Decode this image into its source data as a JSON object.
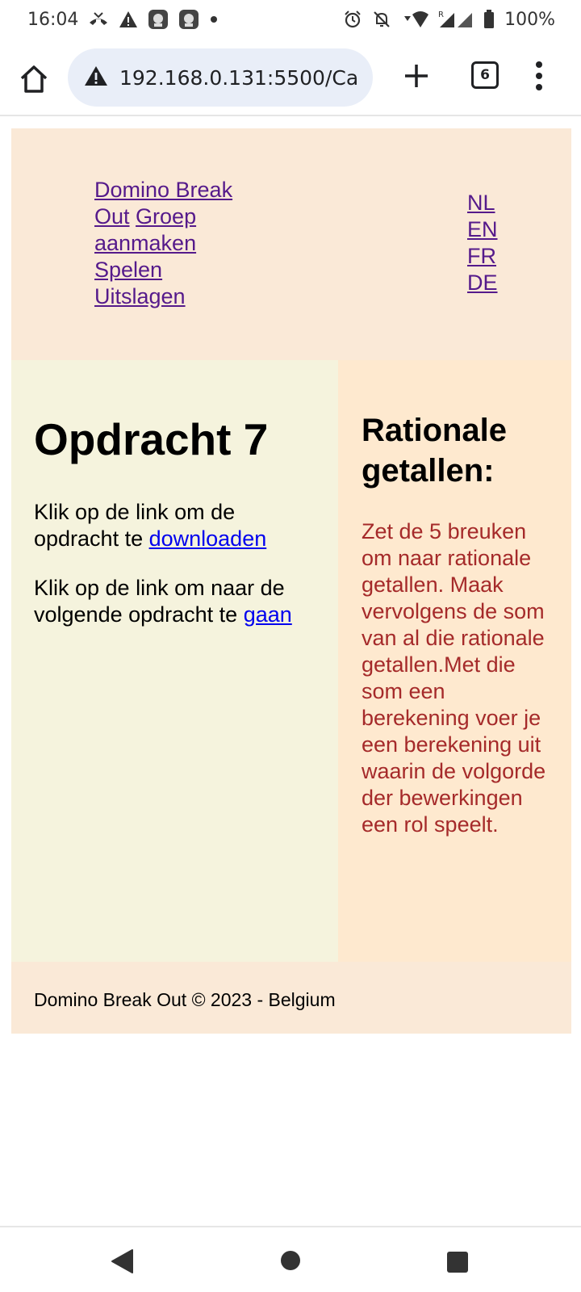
{
  "status_bar": {
    "time": "16:04",
    "battery": "100%",
    "icons_left": [
      "missed-call-icon",
      "warning-icon",
      "app-icon",
      "app-icon",
      "dot-icon"
    ],
    "icons_right": [
      "alarm-icon",
      "mute-icon",
      "wifi-icon",
      "signal-icon",
      "battery-icon"
    ]
  },
  "browser": {
    "url": "192.168.0.131:5500/Ca",
    "tab_count": "6"
  },
  "header": {
    "nav": [
      {
        "label": "Domino Break Out"
      },
      {
        "label": "Groep aanmaken"
      },
      {
        "label": "Spelen"
      },
      {
        "label": "Uitslagen"
      }
    ],
    "languages": [
      "NL",
      "EN",
      "FR",
      "DE"
    ]
  },
  "main": {
    "title": "Opdracht 7",
    "para1_text": "Klik op de link om de opdracht te ",
    "para1_link": "downloaden",
    "para2_text": "Klik op de link om naar de volgende opdracht te ",
    "para2_link": "gaan"
  },
  "aside": {
    "title": "Rationale getallen:",
    "body": "Zet de 5 breuken om naar rationale getallen. Maak vervolgens de som van al die rationale getallen.Met die som een berekening voer je een berekening uit waarin de volgorde der bewerkingen een rol speelt."
  },
  "footer": {
    "text": "Domino Break Out © 2023 - Belgium"
  },
  "colors": {
    "header_bg": "#fae9d7",
    "main_bg": "#f5f3dd",
    "aside_bg": "#fee9cf",
    "aside_text": "#a52a2a",
    "visited_link": "#551a8b",
    "link": "#0000ee"
  }
}
